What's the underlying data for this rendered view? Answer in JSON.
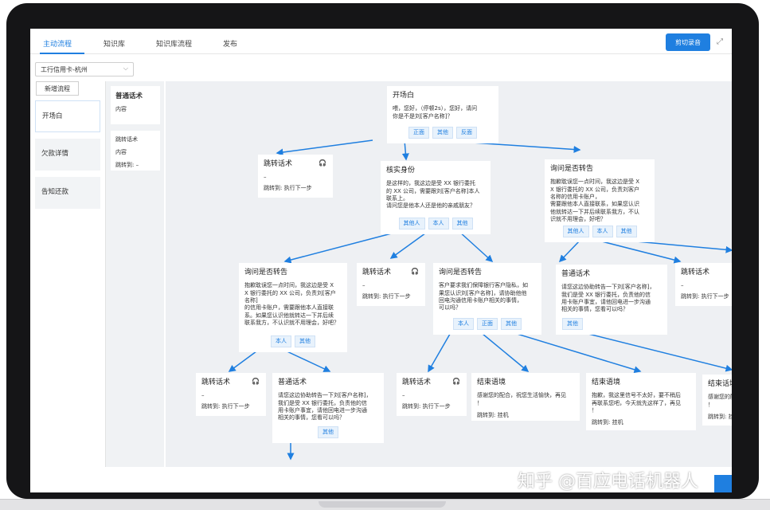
{
  "nav": {
    "tabs": [
      "主动流程",
      "知识库",
      "知识库流程",
      "发布"
    ],
    "record_button": "剪切录音",
    "expand_icon": "⤢"
  },
  "selector": {
    "value": "工行信用卡-杭州",
    "chevron": "⌵"
  },
  "left_menu": {
    "add_button": "新增流程",
    "items": [
      "开场白",
      "欠款详情",
      "告知还款"
    ]
  },
  "script_panel": {
    "card1": {
      "title": "普通话术",
      "content": "内容"
    },
    "card2": {
      "line1": "跳转话术",
      "line2": "内容",
      "line3": "跳转到: –"
    }
  },
  "nodes": {
    "opening": {
      "title": "开场白",
      "text": "喂，您好，（停顿2s），您好，请问\n你是不是刘[客户名称]？",
      "chips": [
        "正面",
        "其他",
        "反面"
      ]
    },
    "jump1": {
      "title": "跳转话术",
      "dash": "–",
      "jump": "跳转到: 执行下一步"
    },
    "verify": {
      "title": "核实身份",
      "text": "是这样的，我这边是受 XX 银行委托\n的 XX 公司，需要跟刘[客户名称]本人\n联系上。\n请问您是他本人还是他的亲戚朋友？",
      "chips": [
        "其他人",
        "本人",
        "其他"
      ]
    },
    "transferR": {
      "title": "询问是否转告",
      "text": "抱歉耽误您一点时间，我这边是受 X\nX 银行委托的 XX 公司，负责刘客户\n名称的信用卡账户，\n需要跟他本人直接联系，如果您认识\n他就转达一下并后续联系我方，不认\n识就不用理会，好吧？",
      "chips": [
        "其他人",
        "本人",
        "其他"
      ]
    },
    "transferL": {
      "title": "询问是否转告",
      "text": "抱歉耽误您一点时间，我这边是受 X\nX 银行委托的 XX 公司，负责刘[客户\n名称]\n的信用卡账户，需要跟他本人直接联\n系。如果您认识他就转达一下并后续\n联系我方，不认识就不用理会，好吧？",
      "chips": [
        "本人",
        "其他"
      ]
    },
    "jump2": {
      "title": "跳转话术",
      "dash": "–",
      "jump": "跳转到: 执行下一步"
    },
    "transferM": {
      "title": "询问是否转告",
      "text": "客户要求我们保障银行客户隐私，如\n果您认识刘[客户名称]，请协助他他\n回电沟通信用卡账户相关的事情，\n可以吗？",
      "chips": [
        "本人",
        "正面",
        "其他"
      ]
    },
    "normal1": {
      "title": "普通话术",
      "text": "请您这边协助转告一下刘[客户名称]，\n我们是受 XX 银行委托，负责他的信\n用卡账户事宜，请他回电进一步沟通\n相关的事情，您看可以吗？",
      "chips": [
        "其他"
      ]
    },
    "jump3": {
      "title": "跳转话术",
      "dash": "–",
      "jump": "跳转到: 执行下一步"
    },
    "jump4": {
      "title": "跳转话术",
      "dash": "–",
      "jump": "跳转到: 执行下一步"
    },
    "normal2": {
      "title": "普通话术",
      "text": "请您这边协助转告一下刘[客户名称]，\n我们是受 XX 银行委托，负责他的信\n用卡账户事宜，请他回电进一步沟通\n相关的事情，您看可以吗？",
      "chips": [
        "其他"
      ]
    },
    "jump5": {
      "title": "跳转话术",
      "dash": "–",
      "jump": "跳转到: 执行下一步"
    },
    "end1": {
      "title": "结束语境",
      "text": "感谢您的配合，祝您生活愉快，再见\n！",
      "jump": "跳转到: 挂机"
    },
    "end2": {
      "title": "结束语境",
      "text": "抱歉，我这里信号不太好，要不稍后\n再联系您吧，今天就先这样了，再见\n！",
      "jump": "跳转到: 挂机"
    },
    "end3": {
      "title": "结束话境",
      "text": "感谢您的配合，祝\n！",
      "jump": "跳转到: 挂机"
    }
  },
  "watermark": "知乎 @百应电话机器人",
  "colors": {
    "accent": "#1f7fe0",
    "canvas": "#eef0f3"
  }
}
